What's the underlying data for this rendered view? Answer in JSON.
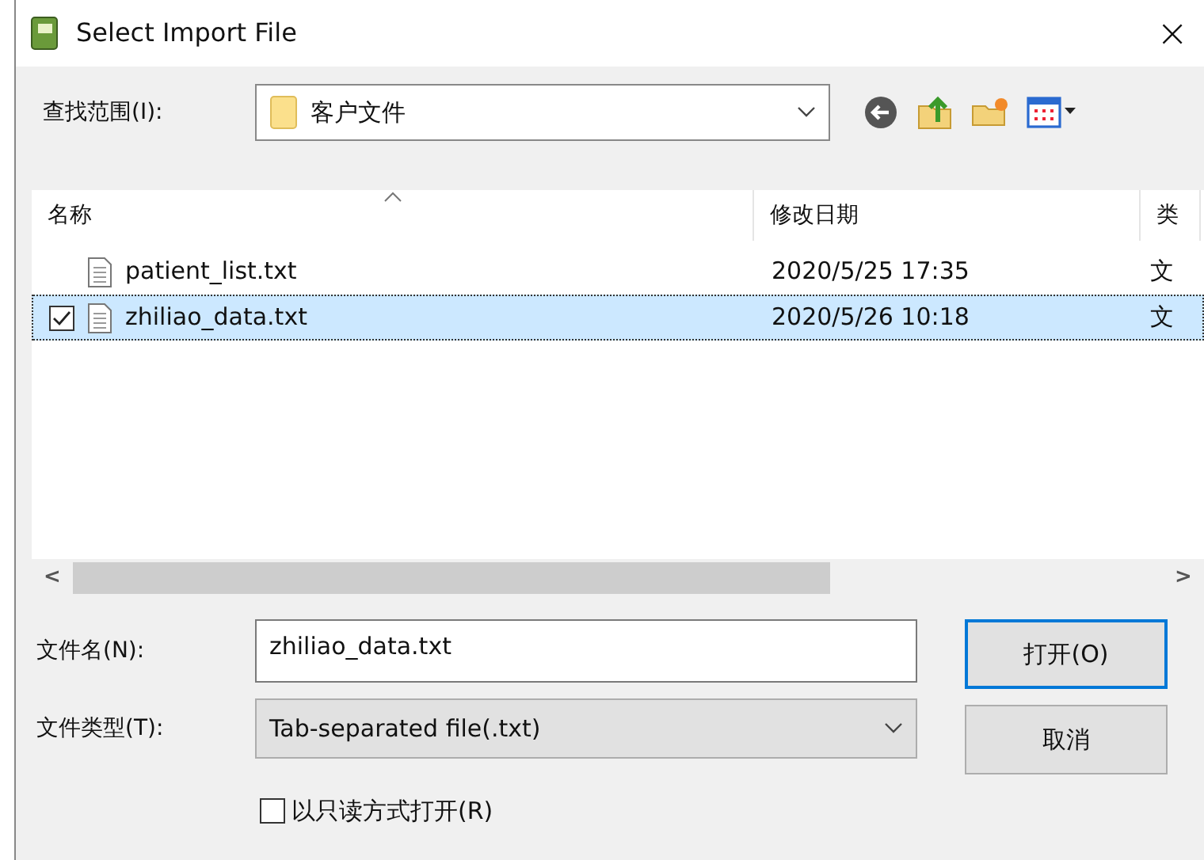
{
  "window": {
    "title": "Select Import File",
    "close": "×"
  },
  "look_in": {
    "label": "查找范围(I):",
    "value": "客户文件"
  },
  "file_list": {
    "columns": [
      {
        "label": "名称",
        "sorted": true
      },
      {
        "label": "修改日期",
        "sorted": false
      },
      {
        "label": "类",
        "sorted": false
      }
    ],
    "rows": [
      {
        "name": "patient_list.txt",
        "date": "2020/5/25 17:35",
        "column_3": "文",
        "selected": false,
        "checked": false
      },
      {
        "name": "zhiliao_data.txt",
        "date": "2020/5/26 10:18",
        "column_3": "文",
        "selected": true,
        "checked": true
      }
    ],
    "scroll_left": "<",
    "scroll_right": ">"
  },
  "file_name": {
    "label": "文件名(N):",
    "value": "zhiliao_data.txt"
  },
  "file_type": {
    "label": "文件类型(T):",
    "value": "Tab-separated file(.txt)"
  },
  "read_only": {
    "label": "以只读方式打开(R)",
    "checked": false
  },
  "buttons": [
    {
      "label": "打开(O)",
      "default": true
    },
    {
      "label": "取消",
      "default": false
    }
  ]
}
